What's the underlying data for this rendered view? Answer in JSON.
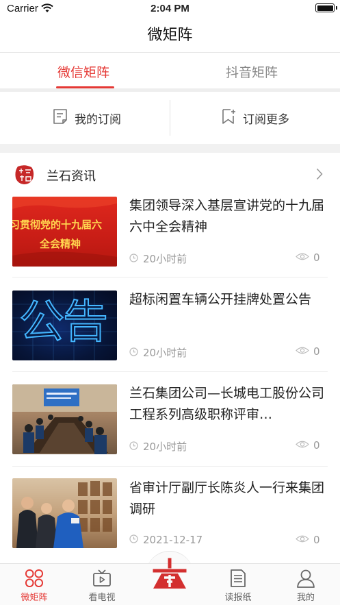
{
  "status_bar": {
    "carrier": "Carrier",
    "time": "2:04 PM"
  },
  "nav": {
    "title": "微矩阵"
  },
  "tabs": [
    {
      "label": "微信矩阵",
      "active": true
    },
    {
      "label": "抖音矩阵",
      "active": false
    }
  ],
  "subscription": {
    "mine": "我的订阅",
    "more": "订阅更多"
  },
  "section": {
    "title": "兰石资讯"
  },
  "news": [
    {
      "title": "集团领导深入基层宣讲党的十九届六中全会精神",
      "time": "20小时前",
      "views": "0",
      "thumb_text_1": "习贯彻党的十九届六",
      "thumb_text_2": "全会精神"
    },
    {
      "title": "超标闲置车辆公开挂牌处置公告",
      "time": "20小时前",
      "views": "0",
      "thumb_text_1": "公告"
    },
    {
      "title": "兰石集团公司—长城电工股份公司工程系列高级职称评审…",
      "time": "20小时前",
      "views": "0"
    },
    {
      "title": "省审计厅副厅长陈炎人一行来集团调研",
      "time": "2021-12-17",
      "views": "0"
    }
  ],
  "tabbar": [
    {
      "label": "微矩阵",
      "icon": "grid-icon",
      "active": true
    },
    {
      "label": "看电视",
      "icon": "tv-icon",
      "active": false
    },
    {
      "label": "",
      "icon": "brand-logo-icon",
      "active": false
    },
    {
      "label": "读报纸",
      "icon": "newspaper-icon",
      "active": false
    },
    {
      "label": "我的",
      "icon": "user-icon",
      "active": false
    }
  ],
  "colors": {
    "accent": "#e53935",
    "muted": "#999999",
    "divider": "#ececec"
  }
}
